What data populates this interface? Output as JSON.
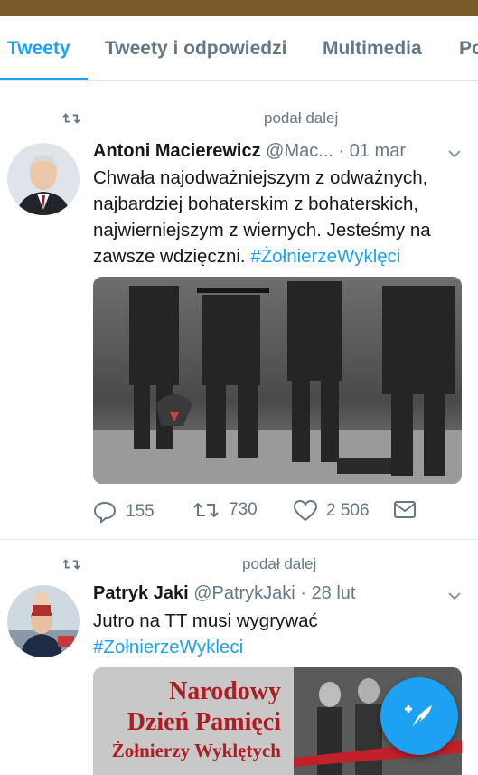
{
  "colors": {
    "accent": "#1da1f2",
    "topbar": "#7a5a2a",
    "secondary_text": "#657786"
  },
  "tabs": [
    {
      "label": "Tweety",
      "active": true
    },
    {
      "label": "Tweety i odpowiedzi",
      "active": false
    },
    {
      "label": "Multimedia",
      "active": false
    },
    {
      "label": "Po",
      "active": false
    }
  ],
  "tweets": [
    {
      "retweet_label": "podał dalej",
      "author_name": "Antoni Macierewicz",
      "handle": "@Mac...",
      "separator": "·",
      "date": "01 mar",
      "text": "Chwała najodważniejszym z odważnych, najbardziej bohaterskim z bohaterskich, najwierniejszym z wiernych. Jesteśmy na zawsze wdzięczni. ",
      "hashtag": "#ŻołnierzeWyklęci",
      "media": "black-and-white photo of soldiers in uniform",
      "actions": {
        "replies": "155",
        "retweets": "730",
        "likes": "2 506"
      }
    },
    {
      "retweet_label": "podał dalej",
      "author_name": "Patryk Jaki",
      "handle": "@PatrykJaki",
      "separator": "·",
      "date": "28 lut",
      "text": "Jutro na TT musi wygrywać",
      "hashtag": "#ZołnierzeWykleci",
      "media_text": [
        "Narodowy",
        "Dzień Pamięci",
        "Żołnierzy Wyklętych"
      ]
    }
  ],
  "icons": {
    "retweet": "retweet-icon",
    "reply": "reply-icon",
    "like": "heart-icon",
    "message": "envelope-icon",
    "chevron": "chevron-down-icon",
    "compose": "compose-feather-icon"
  }
}
